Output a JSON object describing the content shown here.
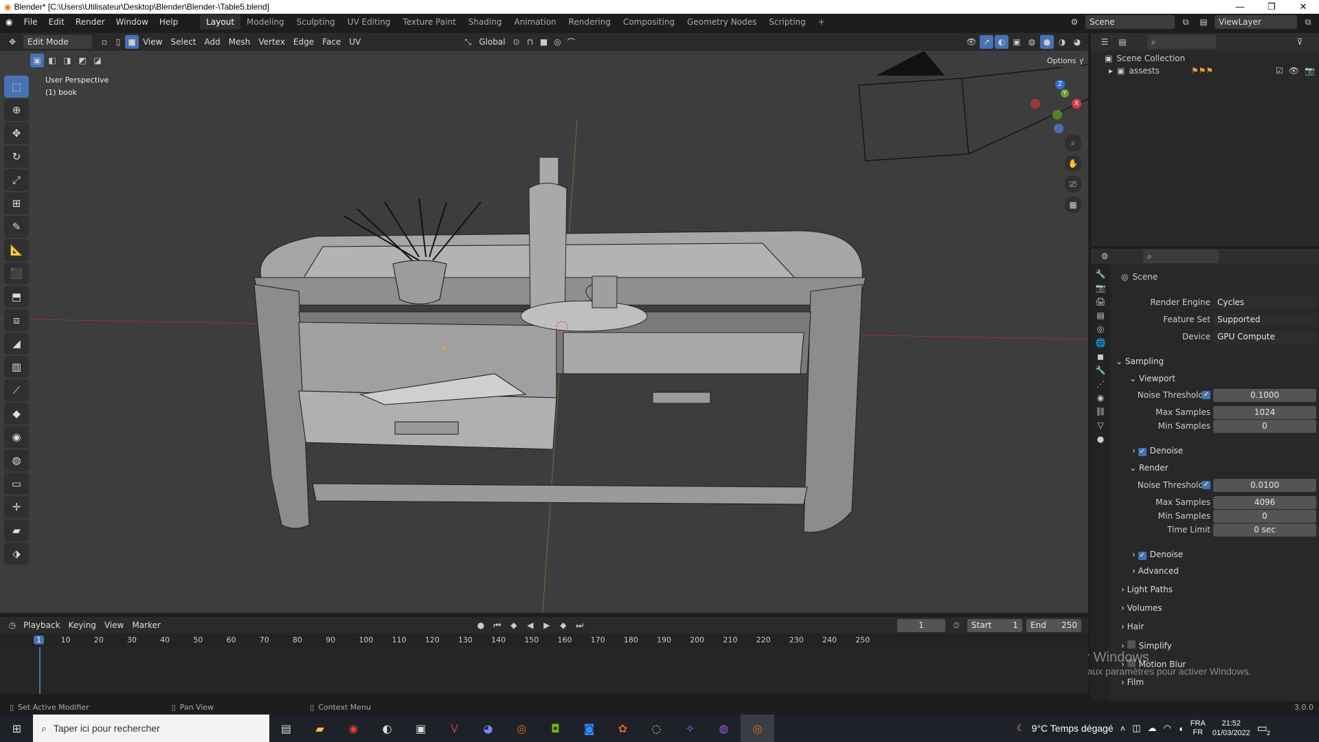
{
  "titlebar": {
    "title": "Blender* [C:\\Users\\Utilisateur\\Desktop\\Blender\\Blender-\\Table5.blend]"
  },
  "menu": [
    "File",
    "Edit",
    "Render",
    "Window",
    "Help"
  ],
  "workspaces": [
    "Layout",
    "Modeling",
    "Sculpting",
    "UV Editing",
    "Texture Paint",
    "Shading",
    "Animation",
    "Rendering",
    "Compositing",
    "Geometry Nodes",
    "Scripting"
  ],
  "active_workspace": "Layout",
  "scene_name": "Scene",
  "view_layer": "ViewLayer",
  "viewport_header": {
    "mode": "Edit Mode",
    "menus": [
      "View",
      "Select",
      "Add",
      "Mesh",
      "Vertex",
      "Edge",
      "Face",
      "UV"
    ],
    "transform_orientation": "Global",
    "options_label": "Options",
    "axes": [
      "X",
      "Y",
      "Z"
    ]
  },
  "viewport": {
    "perspective": "User Perspective",
    "object": "(1) book"
  },
  "gizmo_axes": [
    "Z",
    "Y",
    "X"
  ],
  "outliner": {
    "root": "Scene Collection",
    "items": [
      {
        "name": "assests"
      }
    ]
  },
  "properties": {
    "context": "Scene",
    "render_engine_label": "Render Engine",
    "render_engine": "Cycles",
    "feature_set_label": "Feature Set",
    "feature_set": "Supported",
    "device_label": "Device",
    "device": "GPU Compute",
    "sampling": "Sampling",
    "viewport_sub": "Viewport",
    "noise_threshold_label": "Noise Threshold",
    "max_samples_label": "Max Samples",
    "min_samples_label": "Min Samples",
    "time_limit_label": "Time Limit",
    "vp_noise_threshold": "0.1000",
    "vp_max_samples": "1024",
    "vp_min_samples": "0",
    "denoise_label": "Denoise",
    "render_sub": "Render",
    "r_noise_threshold": "0.0100",
    "r_max_samples": "4096",
    "r_min_samples": "0",
    "r_time_limit": "0 sec",
    "advanced": "Advanced",
    "sections": [
      "Light Paths",
      "Volumes",
      "Hair",
      "Simplify",
      "Motion Blur",
      "Film"
    ]
  },
  "timeline": {
    "menus": [
      "Playback",
      "Keying",
      "View",
      "Marker"
    ],
    "current_frame": "1",
    "start_label": "Start",
    "start": "1",
    "end_label": "End",
    "end": "250",
    "ruler": [
      "1",
      "10",
      "20",
      "30",
      "40",
      "50",
      "60",
      "70",
      "80",
      "90",
      "100",
      "110",
      "120",
      "130",
      "140",
      "150",
      "160",
      "170",
      "180",
      "190",
      "200",
      "210",
      "220",
      "230",
      "240",
      "250"
    ]
  },
  "status": {
    "left": "Set Active Modifier",
    "mid": "Pan View",
    "right": "Context Menu",
    "version": "3.0.0"
  },
  "activate_windows": {
    "title": "Activer Windows",
    "subtitle": "Accédez aux paramètres pour activer Windows."
  },
  "taskbar": {
    "search_placeholder": "Taper ici pour rechercher",
    "weather": "9°C  Temps dégagé",
    "lang1": "FRA",
    "lang2": "FR",
    "time": "21:52",
    "date": "01/03/2022",
    "notif_count": "2"
  }
}
